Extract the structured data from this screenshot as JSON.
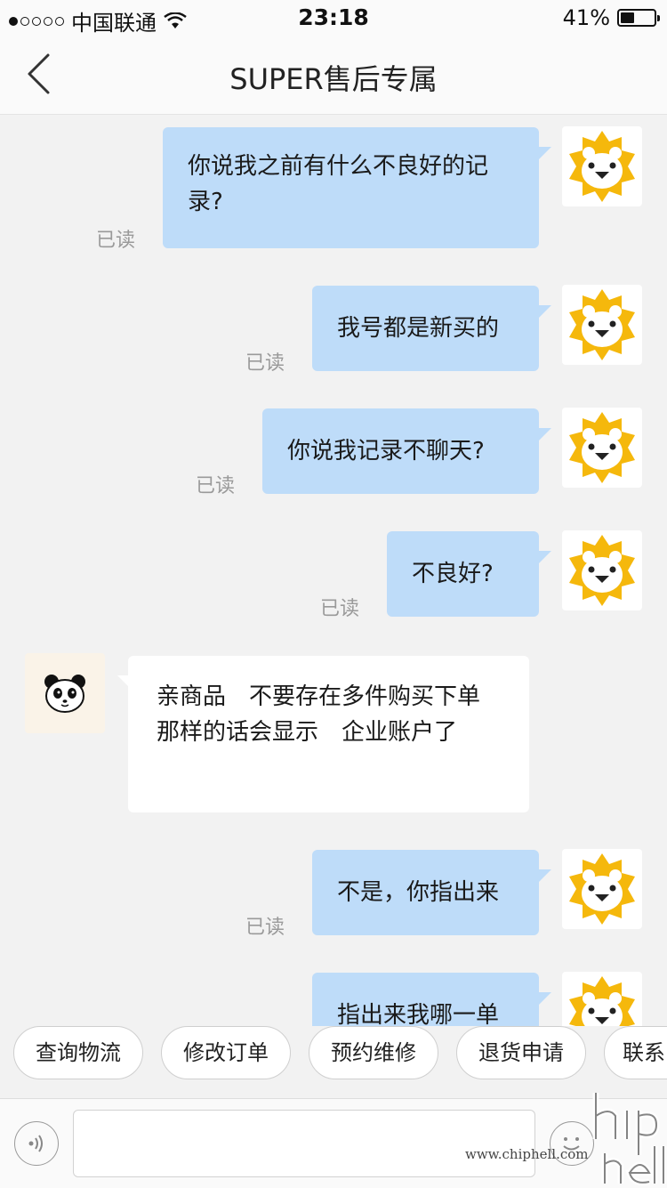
{
  "status_bar": {
    "carrier": "中国联通",
    "time": "23:18",
    "battery_percent_label": "41%",
    "battery_level": 0.41,
    "signal_bars": 1
  },
  "nav": {
    "title": "SUPER售后专属",
    "back_icon": "chevron-left-icon"
  },
  "messages": [
    {
      "side": "out",
      "text": "你说我之前有什么不良好的记录?",
      "read": "已读"
    },
    {
      "side": "out",
      "text": "我号都是新买的",
      "read": "已读"
    },
    {
      "side": "out",
      "text": "你说我记录不聊天?",
      "read": "已读"
    },
    {
      "side": "out",
      "text": "不良好?",
      "read": "已读"
    },
    {
      "side": "in",
      "text": "亲商品　不要存在多件购买下单　那样的话会显示　企业账户了"
    },
    {
      "side": "out",
      "text": "不是，你指出来",
      "read": "已读"
    },
    {
      "side": "out",
      "text": "指出来我哪一单"
    }
  ],
  "quick_replies": [
    "查询物流",
    "修改订单",
    "预约维修",
    "退货申请",
    "联系"
  ],
  "input": {
    "value": "",
    "placeholder": ""
  },
  "watermark": {
    "text": "www.chiphell.com",
    "logo": "chiphell-logo"
  },
  "colors": {
    "outgoing_bubble": "#bedcf9",
    "incoming_bubble": "#ffffff",
    "lion_avatar": "#f5b80c",
    "background": "#f2f2f2"
  }
}
